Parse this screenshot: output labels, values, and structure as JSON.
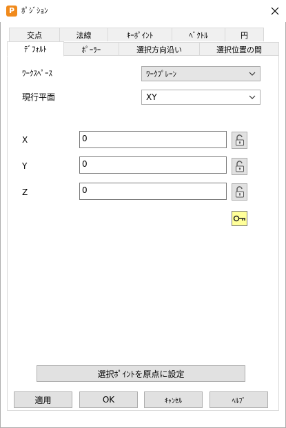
{
  "window": {
    "title": "ﾎﾟｼﾞｼｮﾝ",
    "app_icon_letter": "P"
  },
  "tabs_row1": [
    "交点",
    "法線",
    "ｷｰﾎﾟｲﾝﾄ",
    "ﾍﾞｸﾄﾙ",
    "円"
  ],
  "tabs_row2": [
    "ﾃﾞﾌｫﾙﾄ",
    "ﾎﾟｰﾗｰ",
    "選択方向沿い",
    "選択位置の間"
  ],
  "workspace": {
    "label": "ﾜｰｸｽﾍﾟｰｽ",
    "value": "ﾜｰｸﾌﾟﾚｰﾝ"
  },
  "plane": {
    "label": "現行平面",
    "value": "XY"
  },
  "coords": [
    {
      "label": "X",
      "value": "0"
    },
    {
      "label": "Y",
      "value": "0"
    },
    {
      "label": "Z",
      "value": "0"
    }
  ],
  "set_origin_button": "選択ﾎﾟｲﾝﾄを原点に設定",
  "buttons": {
    "apply": "適用",
    "ok": "OK",
    "cancel": "ｷｬﾝｾﾙ",
    "help": "ﾍﾙﾌﾟ"
  },
  "colors": {
    "app_icon": "#f08a1c",
    "key_icon": "#ffff99"
  }
}
